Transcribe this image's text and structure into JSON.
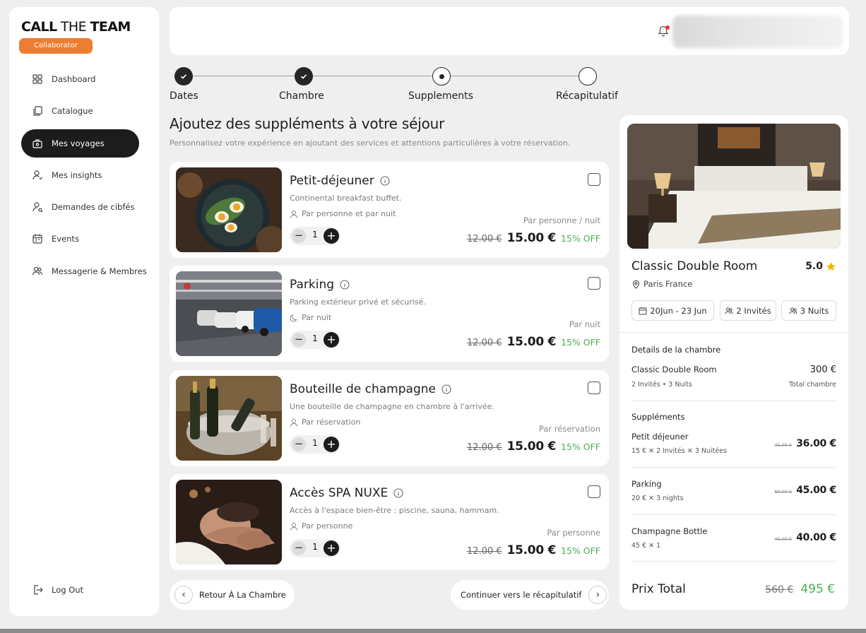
{
  "brand": {
    "bold1": "CALL",
    "light": "THE",
    "bold2": "TEAM",
    "badge": "Collaborator"
  },
  "sidebar": {
    "items": [
      {
        "label": "Dashboard",
        "icon": "grid-icon"
      },
      {
        "label": "Catalogue",
        "icon": "copy-icon"
      },
      {
        "label": "Mes voyages",
        "icon": "suitcase-icon",
        "active": true
      },
      {
        "label": "Mes insights",
        "icon": "user-icon"
      },
      {
        "label": "Demandes de cibfés",
        "icon": "user-search-icon"
      },
      {
        "label": "Events",
        "icon": "calendar-icon"
      },
      {
        "label": "Messagerie & Membres",
        "icon": "users-icon"
      }
    ],
    "logout": "Log Out"
  },
  "stepper": {
    "steps": [
      {
        "label": "Dates",
        "state": "done"
      },
      {
        "label": "Chambre",
        "state": "done"
      },
      {
        "label": "Supplements",
        "state": "current"
      },
      {
        "label": "Récapitulatif",
        "state": "todo"
      }
    ]
  },
  "main": {
    "title": "Ajoutez des suppléments à votre séjour",
    "subtitle": "Personnalisez votre expérience en ajoutant des services et attentions particulières à votre réservation."
  },
  "supplements": [
    {
      "title": "Petit-déjeuner",
      "desc": "Continental breakfast buffet.",
      "unit": "Par personne et par nuit",
      "per": "Par personne / nuit",
      "qty": "1",
      "old": "12.00 €",
      "new": "15.00 €",
      "off": "15% OFF"
    },
    {
      "title": "Parking",
      "desc": "Parking extérieur privé et sécurisé.",
      "unit": "Par nuit",
      "per": "Par nuit",
      "qty": "1",
      "old": "12.00 €",
      "new": "15.00 €",
      "off": "15% OFF"
    },
    {
      "title": "Bouteille de champagne",
      "desc": "Une bouteille de champagne en chambre à l'arrivée.",
      "unit": "Par réservation",
      "per": "Par réservation",
      "qty": "1",
      "old": "12.00 €",
      "new": "15.00 €",
      "off": "15% OFF"
    },
    {
      "title": "Accès SPA NUXE",
      "desc": "Accès à l'espace bien-être : piscine, sauna, hammam.",
      "unit": "Par personne",
      "per": "Par personne",
      "qty": "1",
      "old": "12.00 €",
      "new": "15.00 €",
      "off": "15% OFF"
    }
  ],
  "buttons": {
    "back": "Retour À La Chambre",
    "next": "Continuer vers le récapitulatif"
  },
  "summary": {
    "room_title": "Classic Double Room",
    "rating": "5.0",
    "location": "Paris France",
    "chips": {
      "dates": "20Jun - 23 Jun",
      "guests": "2 Invités",
      "nights": "3 Nuits"
    },
    "details_title": "Details de la chambre",
    "room_line": "Classic Double Room",
    "room_price": "300 €",
    "room_sub": "2 Invités  •  3 Nuits",
    "room_sub_right": "Total chambre",
    "supp_title": "Suppléments",
    "lines": [
      {
        "name": "Petit déjeuner",
        "calc": "15 €  ✕  2 Invités  ✕  3 Nuitées",
        "old": "45.00 €",
        "new": "36.00 €"
      },
      {
        "name": "Parking",
        "calc": "20 €  ✕  3 nights",
        "old": "60.00 €",
        "new": "45.00 €"
      },
      {
        "name": "Champagne Bottle",
        "calc": "45 €  ✕  1",
        "old": "45.00 €",
        "new": "40.00 €"
      }
    ],
    "total_label": "Prix Total",
    "total_old": "560 €",
    "total_new": "495 €"
  },
  "colors": {
    "accent": "#ec7d32",
    "success": "#4caf50",
    "dark": "#1c1c1c"
  }
}
